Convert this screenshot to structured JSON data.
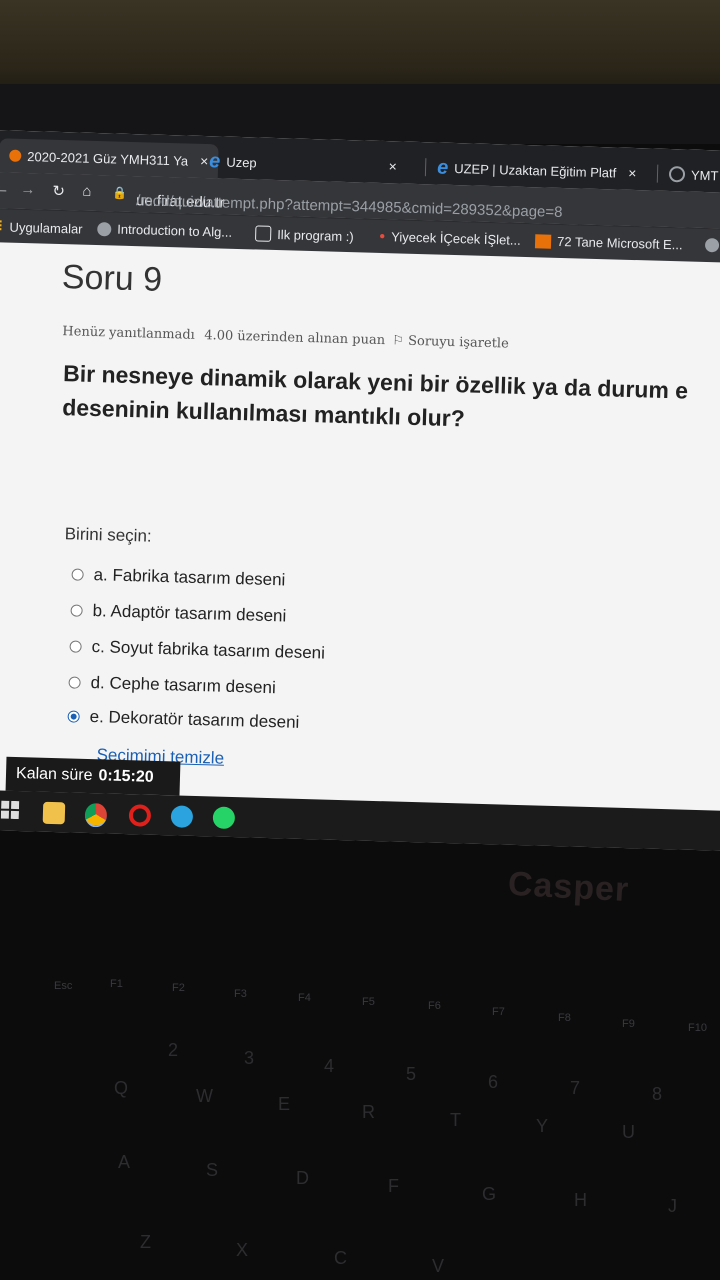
{
  "browser": {
    "tabs": [
      {
        "title": "2020-2021 Güz YMH311 Ya",
        "close": "×"
      },
      {
        "title": "Uzep",
        "close": "×"
      },
      {
        "title": "UZEP | Uzaktan Eğitim Platf",
        "close": "×"
      },
      {
        "title": "YMT"
      }
    ],
    "url_host": "ue.firat.edu.tr",
    "url_path": "/mod/quiz/attempt.php?attempt=344985&cmid=289352&page=8",
    "bookmarks": [
      "Uygulamalar",
      "Introduction to Alg...",
      "Ilk program :)",
      "Yiyecek İÇecek İŞlet...",
      "72 Tane Microsoft E..."
    ]
  },
  "quiz": {
    "title": "Soru 9",
    "status": "Henüz yanıtlanmadı",
    "points": "4.00 üzerinden alınan puan",
    "flag": "Soruyu işaretle",
    "question_line1": "Bir nesneye dinamik olarak yeni bir özellik ya da durum e",
    "question_line2": "deseninin kullanılması mantıklı olur?",
    "prompt": "Birini seçin:",
    "options": [
      {
        "label": "a. Fabrika tasarım deseni",
        "selected": false
      },
      {
        "label": "b. Adaptör tasarım deseni",
        "selected": false
      },
      {
        "label": "c. Soyut fabrika tasarım deseni",
        "selected": false
      },
      {
        "label": "d. Cephe tasarım deseni",
        "selected": false
      },
      {
        "label": "e. Dekoratör tasarım deseni",
        "selected": true
      }
    ],
    "clear_choice": "Seçimimi temizle",
    "timer_label": "Kalan süre",
    "timer_value": "0:15:20"
  },
  "laptop": {
    "brand": "Casper"
  },
  "colors": {
    "link": "#1a5fb4",
    "browser_dark": "#202124"
  }
}
